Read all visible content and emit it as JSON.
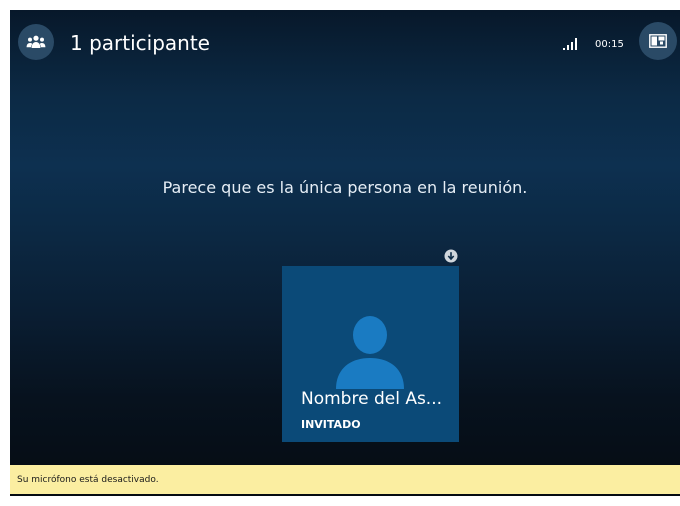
{
  "header": {
    "title": "1 participante",
    "timer": "00:15",
    "people_icon": "people-icon",
    "signal_icon": "signal-bars-icon",
    "layout_icon": "layout-switch-icon"
  },
  "stage": {
    "message": "Parece que es la única persona en la reunión."
  },
  "tile": {
    "name": "Nombre del As...",
    "role": "INVITADO",
    "avatar_icon": "person-avatar-icon",
    "corner_icon": "download-arrow-icon"
  },
  "notification": {
    "text": "Su micrófono está desactivado."
  },
  "colors": {
    "tile_background": "#0b4a78",
    "avatar": "#1a7bc2",
    "notification_background": "#fbeea1",
    "button_background": "#2a4a66"
  }
}
